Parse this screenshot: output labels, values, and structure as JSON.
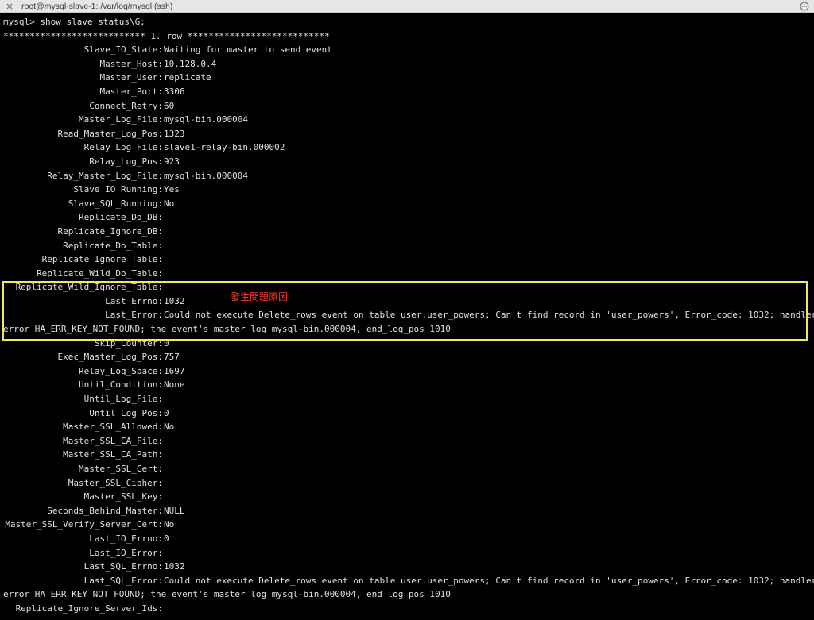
{
  "window": {
    "title": "root@mysql-slave-1: /var/log/mysql (ssh)"
  },
  "terminal": {
    "prompt_line": "mysql> show slave status\\G;",
    "row_header": "*************************** 1. row ***************************",
    "fields": [
      {
        "label": "Slave_IO_State:",
        "value": "Waiting for master to send event"
      },
      {
        "label": "Master_Host:",
        "value": "10.128.0.4"
      },
      {
        "label": "Master_User:",
        "value": "replicate"
      },
      {
        "label": "Master_Port:",
        "value": "3306"
      },
      {
        "label": "Connect_Retry:",
        "value": "60"
      },
      {
        "label": "Master_Log_File:",
        "value": "mysql-bin.000004"
      },
      {
        "label": "Read_Master_Log_Pos:",
        "value": "1323"
      },
      {
        "label": "Relay_Log_File:",
        "value": "slave1-relay-bin.000002"
      },
      {
        "label": "Relay_Log_Pos:",
        "value": "923"
      },
      {
        "label": "Relay_Master_Log_File:",
        "value": "mysql-bin.000004"
      },
      {
        "label": "Slave_IO_Running:",
        "value": "Yes"
      },
      {
        "label": "Slave_SQL_Running:",
        "value": "No"
      },
      {
        "label": "Replicate_Do_DB:",
        "value": ""
      },
      {
        "label": "Replicate_Ignore_DB:",
        "value": ""
      },
      {
        "label": "Replicate_Do_Table:",
        "value": ""
      },
      {
        "label": "Replicate_Ignore_Table:",
        "value": ""
      },
      {
        "label": "Replicate_Wild_Do_Table:",
        "value": ""
      },
      {
        "label": "Replicate_Wild_Ignore_Table:",
        "value": ""
      },
      {
        "label": "Last_Errno:",
        "value": "1032"
      },
      {
        "label": "Last_Error:",
        "value": "Could not execute Delete_rows event on table user.user_powers; Can't find record in 'user_powers', Error_code: 1032; handler",
        "wrap": "error HA_ERR_KEY_NOT_FOUND; the event's master log mysql-bin.000004, end_log_pos 1010"
      },
      {
        "label": "Skip_Counter:",
        "value": "0"
      },
      {
        "label": "Exec_Master_Log_Pos:",
        "value": "757"
      },
      {
        "label": "Relay_Log_Space:",
        "value": "1697"
      },
      {
        "label": "Until_Condition:",
        "value": "None"
      },
      {
        "label": "Until_Log_File:",
        "value": ""
      },
      {
        "label": "Until_Log_Pos:",
        "value": "0"
      },
      {
        "label": "Master_SSL_Allowed:",
        "value": "No"
      },
      {
        "label": "Master_SSL_CA_File:",
        "value": ""
      },
      {
        "label": "Master_SSL_CA_Path:",
        "value": ""
      },
      {
        "label": "Master_SSL_Cert:",
        "value": ""
      },
      {
        "label": "Master_SSL_Cipher:",
        "value": ""
      },
      {
        "label": "Master_SSL_Key:",
        "value": ""
      },
      {
        "label": "Seconds_Behind_Master:",
        "value": "NULL"
      },
      {
        "label": "Master_SSL_Verify_Server_Cert:",
        "value": "No"
      },
      {
        "label": "Last_IO_Errno:",
        "value": "0"
      },
      {
        "label": "Last_IO_Error:",
        "value": ""
      },
      {
        "label": "Last_SQL_Errno:",
        "value": "1032"
      },
      {
        "label": "Last_SQL_Error:",
        "value": "Could not execute Delete_rows event on table user.user_powers; Can't find record in 'user_powers', Error_code: 1032; handler",
        "wrap": "error HA_ERR_KEY_NOT_FOUND; the event's master log mysql-bin.000004, end_log_pos 1010"
      },
      {
        "label": "Replicate_Ignore_Server_Ids:",
        "value": ""
      }
    ]
  },
  "annotation": {
    "text": "發生問題原因",
    "color": "#ff3b30",
    "box_color": "#f2e85c"
  },
  "icons": {
    "close": "close-icon",
    "more": "more-options-icon"
  }
}
